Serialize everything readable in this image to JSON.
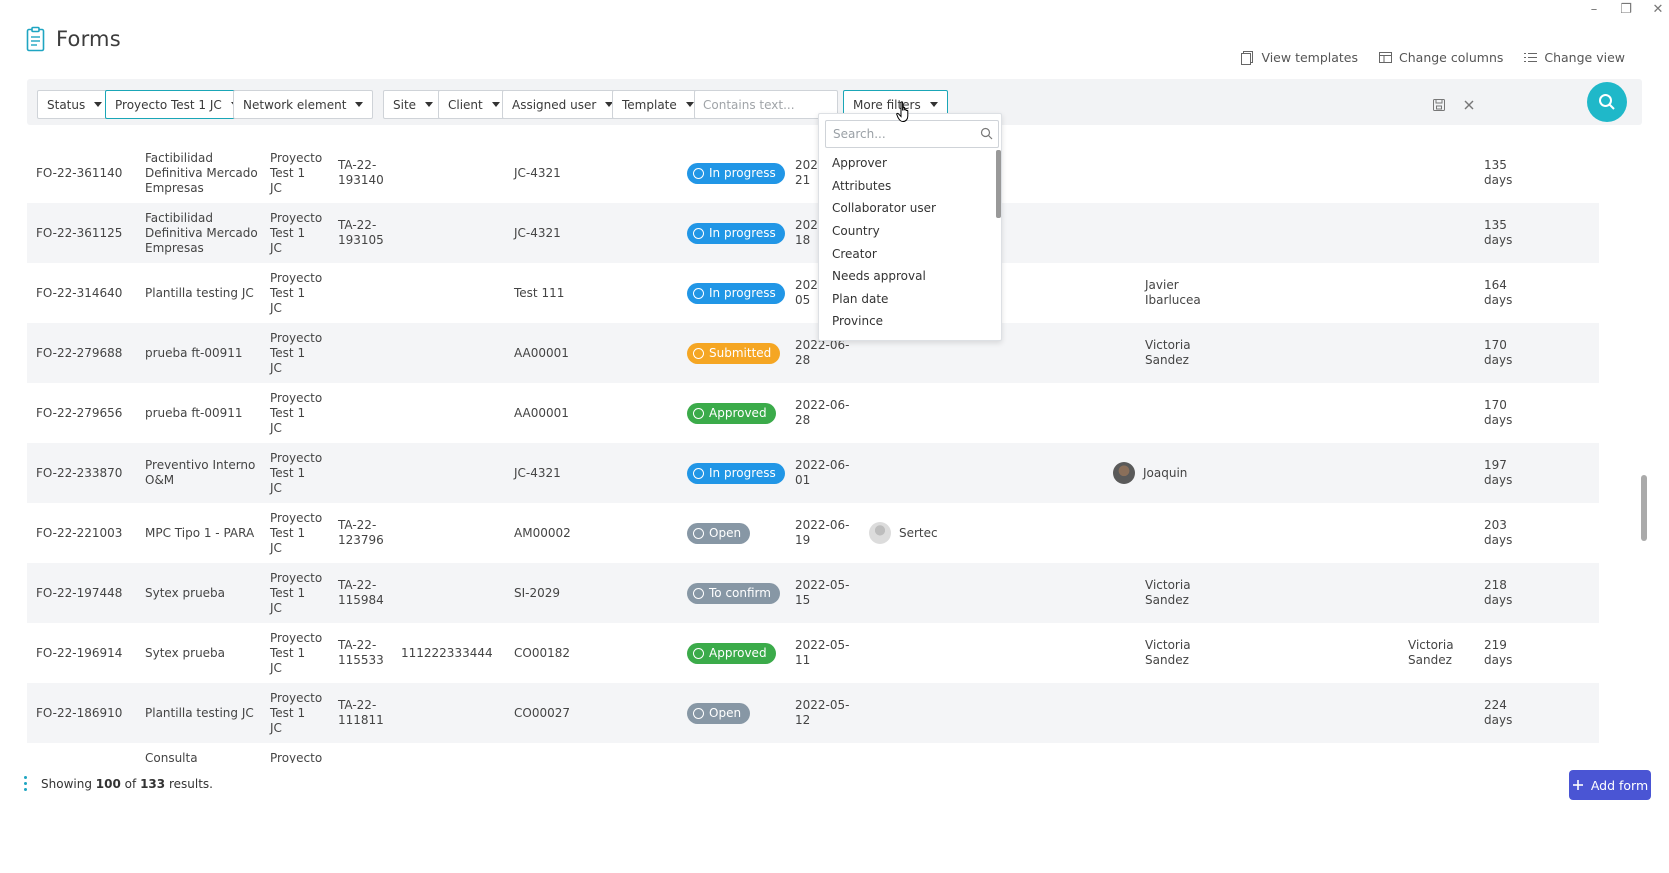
{
  "app": {
    "title": "Forms",
    "window_controls": [
      "minimize-icon",
      "restore-icon",
      "close-icon"
    ]
  },
  "top_actions": {
    "view_templates": "View templates",
    "change_columns": "Change columns",
    "change_view": "Change view"
  },
  "filters": {
    "status": "Status",
    "project": "Proyecto Test 1 JC",
    "network_element": "Network element",
    "site": "Site",
    "client": "Client",
    "assigned_user": "Assigned user",
    "template": "Template",
    "text_placeholder": "Contains text...",
    "more_filters": "More filters"
  },
  "more_filters_menu": {
    "search_placeholder": "Search...",
    "items": [
      "Approver",
      "Attributes",
      "Collaborator user",
      "Country",
      "Creator",
      "Needs approval",
      "Plan date",
      "Province"
    ]
  },
  "status_colors": {
    "In progress": "#2196e6",
    "Submitted": "#f5a623",
    "Approved": "#3bab4a",
    "Open": "#8797a5",
    "To confirm": "#8797a5"
  },
  "rows": [
    {
      "id": "FO-22-361140",
      "name": "Factibilidad Definitiva Mercado Empresas",
      "project": "Proyecto Test 1 JC",
      "task": "TA-22-193140",
      "element": "",
      "site": "JC-4321",
      "status": "In progress",
      "date": "2022-06-21",
      "date_visible": "202\n21",
      "assigned": "",
      "user": "",
      "collab": "",
      "age": "135 days"
    },
    {
      "id": "FO-22-361125",
      "name": "Factibilidad Definitiva Mercado Empresas",
      "project": "Proyecto Test 1 JC",
      "task": "TA-22-193105",
      "element": "",
      "site": "JC-4321",
      "status": "In progress",
      "date_visible": "202\n18",
      "assigned": "",
      "user": "",
      "collab": "",
      "age": "135 days"
    },
    {
      "id": "FO-22-314640",
      "name": "Plantilla testing JC",
      "project": "Proyecto Test 1 JC",
      "task": "",
      "element": "",
      "site": "Test 111",
      "status": "In progress",
      "date_visible": "202\n05",
      "assigned": "",
      "user": "Javier Ibarlucea",
      "collab": "",
      "age": "164 days"
    },
    {
      "id": "FO-22-279688",
      "name": "prueba ft-00911",
      "project": "Proyecto Test 1 JC",
      "task": "",
      "element": "",
      "site": "AA00001",
      "status": "Submitted",
      "date_visible": "2022-06-\n28",
      "assigned": "",
      "user": "Victoria Sandez",
      "collab": "",
      "age": "170 days"
    },
    {
      "id": "FO-22-279656",
      "name": "prueba ft-00911",
      "project": "Proyecto Test 1 JC",
      "task": "",
      "element": "",
      "site": "AA00001",
      "status": "Approved",
      "date_visible": "2022-06-\n28",
      "assigned": "",
      "user": "",
      "collab": "",
      "age": "170 days"
    },
    {
      "id": "FO-22-233870",
      "name": "Preventivo Interno O&M",
      "project": "Proyecto Test 1 JC",
      "task": "",
      "element": "",
      "site": "JC-4321",
      "status": "In progress",
      "date_visible": "2022-06-\n01",
      "assigned": "",
      "user": "Joaquin",
      "user_avatar": true,
      "collab": "",
      "age": "197 days"
    },
    {
      "id": "FO-22-221003",
      "name": "MPC Tipo 1 - PARA",
      "project": "Proyecto Test 1 JC",
      "task": "TA-22-123796",
      "element": "",
      "site": "AM00002",
      "status": "Open",
      "date_visible": "2022-06-\n19",
      "assigned": "Sertec",
      "assigned_avatar": true,
      "user": "",
      "collab": "",
      "age": "203 days"
    },
    {
      "id": "FO-22-197448",
      "name": "Sytex prueba",
      "project": "Proyecto Test 1 JC",
      "task": "TA-22-115984",
      "element": "",
      "site": "SI-2029",
      "status": "To confirm",
      "date_visible": "2022-05-\n15",
      "assigned": "",
      "user": "Victoria Sandez",
      "collab": "",
      "age": "218 days"
    },
    {
      "id": "FO-22-196914",
      "name": "Sytex prueba",
      "project": "Proyecto Test 1 JC",
      "task": "TA-22-115533",
      "element": "111222333444",
      "site": "CO00182",
      "status": "Approved",
      "date_visible": "2022-05-\n11",
      "assigned": "",
      "user": "Victoria Sandez",
      "collab": "Victoria Sandez",
      "age": "219 days"
    },
    {
      "id": "FO-22-186910",
      "name": "Plantilla testing JC",
      "project": "Proyecto Test 1 JC",
      "task": "TA-22-111811",
      "element": "",
      "site": "CO00027",
      "status": "Open",
      "date_visible": "2022-05-\n12",
      "assigned": "",
      "user": "",
      "collab": "",
      "age": "224 days"
    },
    {
      "id": "",
      "name": "Consulta",
      "project": "Proyecto",
      "task": "",
      "element": "",
      "site": "",
      "status": "",
      "date_visible": "",
      "assigned": "",
      "user": "",
      "collab": "",
      "age": ""
    }
  ],
  "footer": {
    "prefix": "Showing",
    "shown": "100",
    "of": "of",
    "total": "133",
    "suffix": "results.",
    "add_form": "Add form"
  }
}
